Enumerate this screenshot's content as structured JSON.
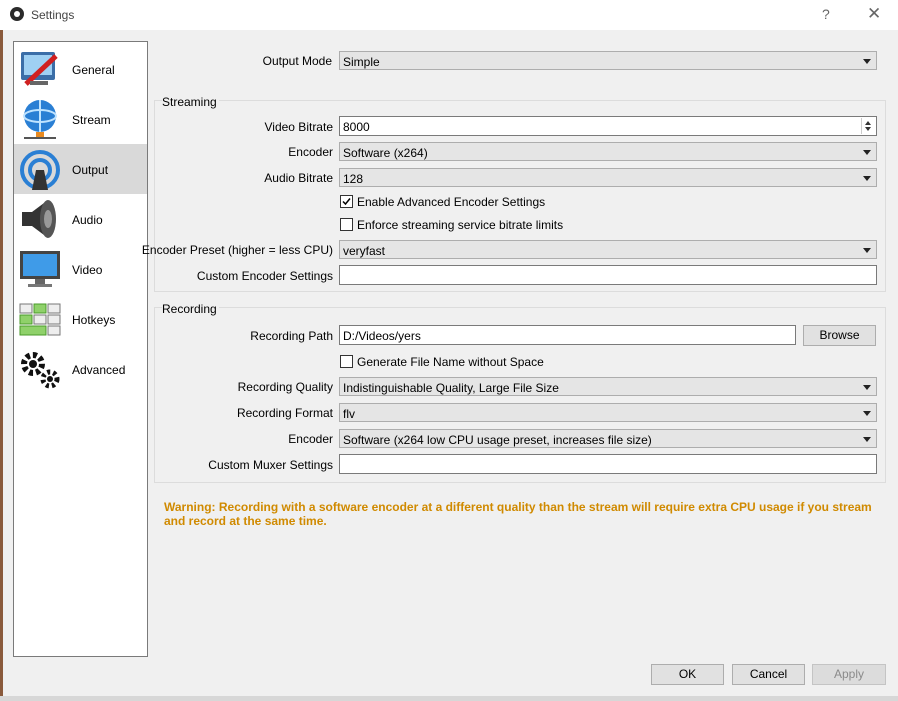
{
  "window": {
    "title": "Settings",
    "help_glyph": "?",
    "close_glyph": "✕"
  },
  "sidebar": {
    "items": [
      {
        "label": "General",
        "icon": "general-icon"
      },
      {
        "label": "Stream",
        "icon": "stream-icon"
      },
      {
        "label": "Output",
        "icon": "output-icon",
        "selected": true
      },
      {
        "label": "Audio",
        "icon": "audio-icon"
      },
      {
        "label": "Video",
        "icon": "video-icon"
      },
      {
        "label": "Hotkeys",
        "icon": "hotkeys-icon"
      },
      {
        "label": "Advanced",
        "icon": "advanced-icon"
      }
    ]
  },
  "output_mode": {
    "label": "Output Mode",
    "value": "Simple"
  },
  "streaming": {
    "title": "Streaming",
    "video_bitrate": {
      "label": "Video Bitrate",
      "value": "8000"
    },
    "encoder": {
      "label": "Encoder",
      "value": "Software (x264)"
    },
    "audio_bitrate": {
      "label": "Audio Bitrate",
      "value": "128"
    },
    "advanced_encoder": {
      "label": "Enable Advanced Encoder Settings",
      "checked": true
    },
    "enforce_limits": {
      "label": "Enforce streaming service bitrate limits",
      "checked": false
    },
    "encoder_preset": {
      "label": "Encoder Preset (higher = less CPU)",
      "value": "veryfast"
    },
    "custom_encoder": {
      "label": "Custom Encoder Settings",
      "value": ""
    }
  },
  "recording": {
    "title": "Recording",
    "path": {
      "label": "Recording Path",
      "value": "D:/Videos/yers"
    },
    "browse_label": "Browse",
    "no_space": {
      "label": "Generate File Name without Space",
      "checked": false
    },
    "quality": {
      "label": "Recording Quality",
      "value": "Indistinguishable Quality, Large File Size"
    },
    "format": {
      "label": "Recording Format",
      "value": "flv"
    },
    "encoder": {
      "label": "Encoder",
      "value": "Software (x264 low CPU usage preset, increases file size)"
    },
    "muxer": {
      "label": "Custom Muxer Settings",
      "value": ""
    }
  },
  "warning": "Warning: Recording with a software encoder at a different quality than the stream will require extra CPU usage if you stream and record at the same time.",
  "buttons": {
    "ok": "OK",
    "cancel": "Cancel",
    "apply": "Apply"
  },
  "colors": {
    "warning": "#d08a00",
    "selected_item": "#d9d9d9"
  }
}
